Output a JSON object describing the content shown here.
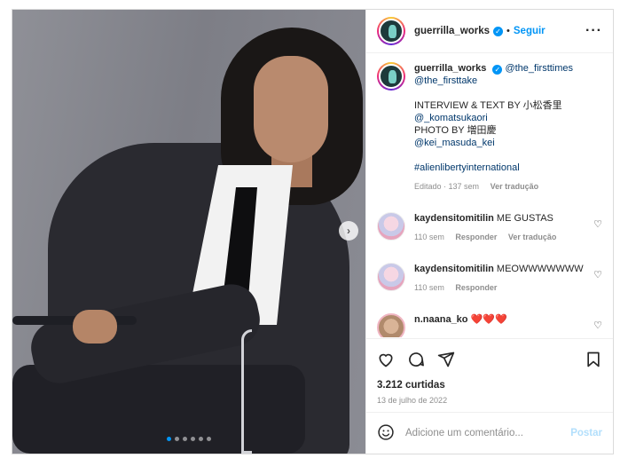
{
  "header": {
    "username": "guerrilla_works",
    "dot": "•",
    "follow_label": "Seguir",
    "more_icon": "more-horizontal-icon"
  },
  "caption": {
    "username": "guerrilla_works",
    "tag1": "@the_firsttimes",
    "tag2": "@the_firsttake",
    "line1": "INTERVIEW & TEXT BY 小松香里",
    "handle1": "@_komatsukaori",
    "line2": "PHOTO BY 増田慶",
    "handle2": "@kei_masuda_kei",
    "hashtag": "#alienlibertyinternational",
    "edited": "Editado · 137 sem",
    "translate": "Ver tradução"
  },
  "comments": [
    {
      "user": "kaydensitomitilin",
      "text": "ME GUSTAS",
      "age": "110 sem",
      "reply": "Responder",
      "translate": "Ver tradução"
    },
    {
      "user": "kaydensitomitilin",
      "text": "MEOWWWWWWW",
      "age": "110 sem",
      "reply": "Responder"
    },
    {
      "user": "n.naana_ko",
      "text": "❤️❤️❤️"
    }
  ],
  "actions": {
    "likes": "3.212 curtidas",
    "date": "13 de julho de 2022"
  },
  "add_comment": {
    "placeholder": "Adicione um comentário...",
    "post_label": "Postar"
  },
  "carousel": {
    "next": "›",
    "current_index": 1,
    "total": 6
  },
  "colors": {
    "accent": "#0095f6",
    "post_disabled": "#b2dffc",
    "muted": "#8e8e8e"
  }
}
